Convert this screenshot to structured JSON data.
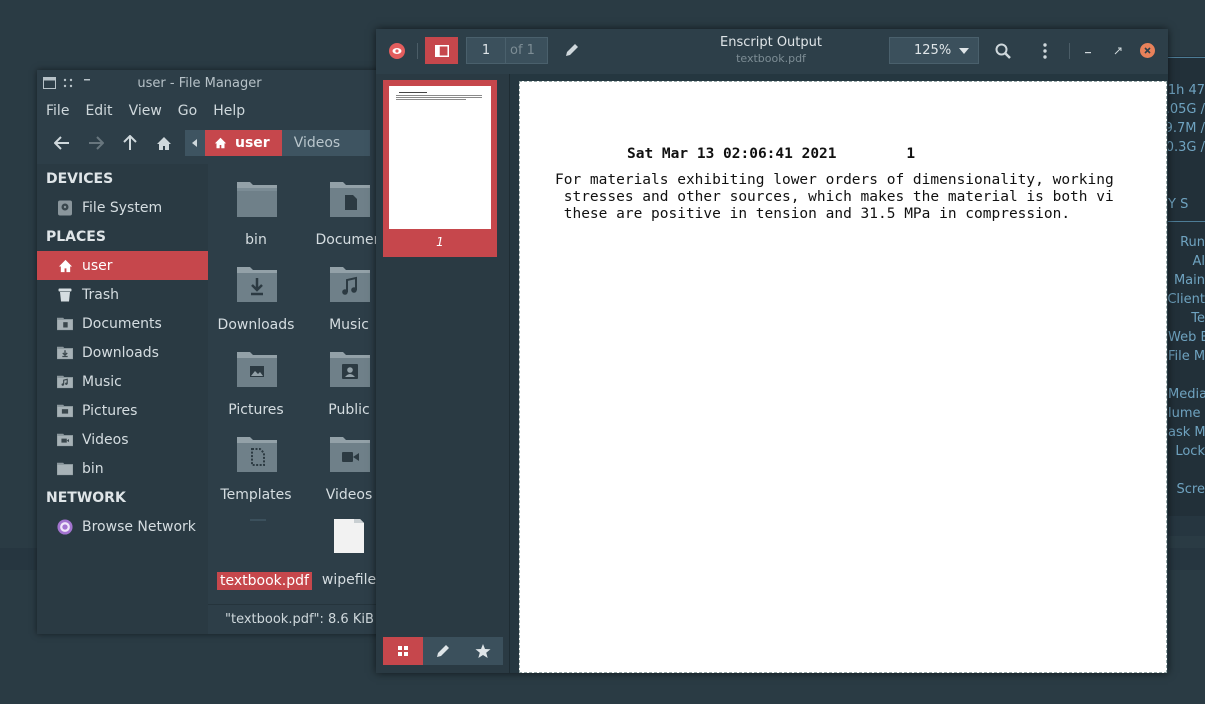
{
  "file_manager": {
    "title": "user - File Manager",
    "menu": [
      "File",
      "Edit",
      "View",
      "Go",
      "Help"
    ],
    "path": {
      "current": "user",
      "next": "Videos"
    },
    "sidebar": {
      "devices_header": "DEVICES",
      "devices": [
        {
          "label": "File System",
          "icon": "drive-icon"
        }
      ],
      "places_header": "PLACES",
      "places": [
        {
          "label": "user",
          "icon": "home-icon",
          "selected": true
        },
        {
          "label": "Trash",
          "icon": "trash-icon"
        },
        {
          "label": "Documents",
          "icon": "folder-documents-icon"
        },
        {
          "label": "Downloads",
          "icon": "folder-downloads-icon"
        },
        {
          "label": "Music",
          "icon": "folder-music-icon"
        },
        {
          "label": "Pictures",
          "icon": "folder-pictures-icon"
        },
        {
          "label": "Videos",
          "icon": "folder-videos-icon"
        },
        {
          "label": "bin",
          "icon": "folder-icon"
        }
      ],
      "network_header": "NETWORK",
      "network": [
        {
          "label": "Browse Network",
          "icon": "network-icon"
        }
      ]
    },
    "files": [
      {
        "label": "bin",
        "icon": "folder-icon"
      },
      {
        "label": "Documen",
        "icon": "folder-documents-icon"
      },
      {
        "label": "Downloads",
        "icon": "folder-downloads-icon"
      },
      {
        "label": "Music",
        "icon": "folder-music-icon"
      },
      {
        "label": "Pictures",
        "icon": "folder-pictures-icon"
      },
      {
        "label": "Public",
        "icon": "folder-public-icon"
      },
      {
        "label": "Templates",
        "icon": "folder-templates-icon"
      },
      {
        "label": "Videos",
        "icon": "folder-videos-icon"
      },
      {
        "label": "textbook.pdf",
        "icon": "pdf-file-icon",
        "selected": true
      },
      {
        "label": "wipefile",
        "icon": "file-icon"
      }
    ],
    "status": "\"textbook.pdf\": 8.6 KiB (8"
  },
  "pdf_viewer": {
    "title": "Enscript Output",
    "subtitle": "textbook.pdf",
    "page_number": "1",
    "page_total": "of 1",
    "zoom": "125%",
    "thumbnail_label": "1",
    "document": {
      "header": "Sat Mar 13 02:06:41 2021        1",
      "lines": [
        "For materials exhibiting lower orders of dimensionality, working",
        " stresses and other sources, which makes the material is both vi",
        " these are positive in tension and 31.5 MPa in compression."
      ]
    }
  },
  "conky": {
    "lines_top": [
      "1h 47",
      ".05G /",
      "9.7M /",
      "0.3G /"
    ],
    "heading": "Y S",
    "lines_bottom": [
      "Run",
      "Al",
      "Main",
      "Client",
      "Te",
      "Web B",
      "File M",
      "Media",
      "lume C",
      "ask M",
      "Lock",
      "Scre"
    ]
  },
  "colors": {
    "accent": "#c6474c",
    "window_bg": "#2d3e48",
    "desktop": "#2a3b44"
  }
}
